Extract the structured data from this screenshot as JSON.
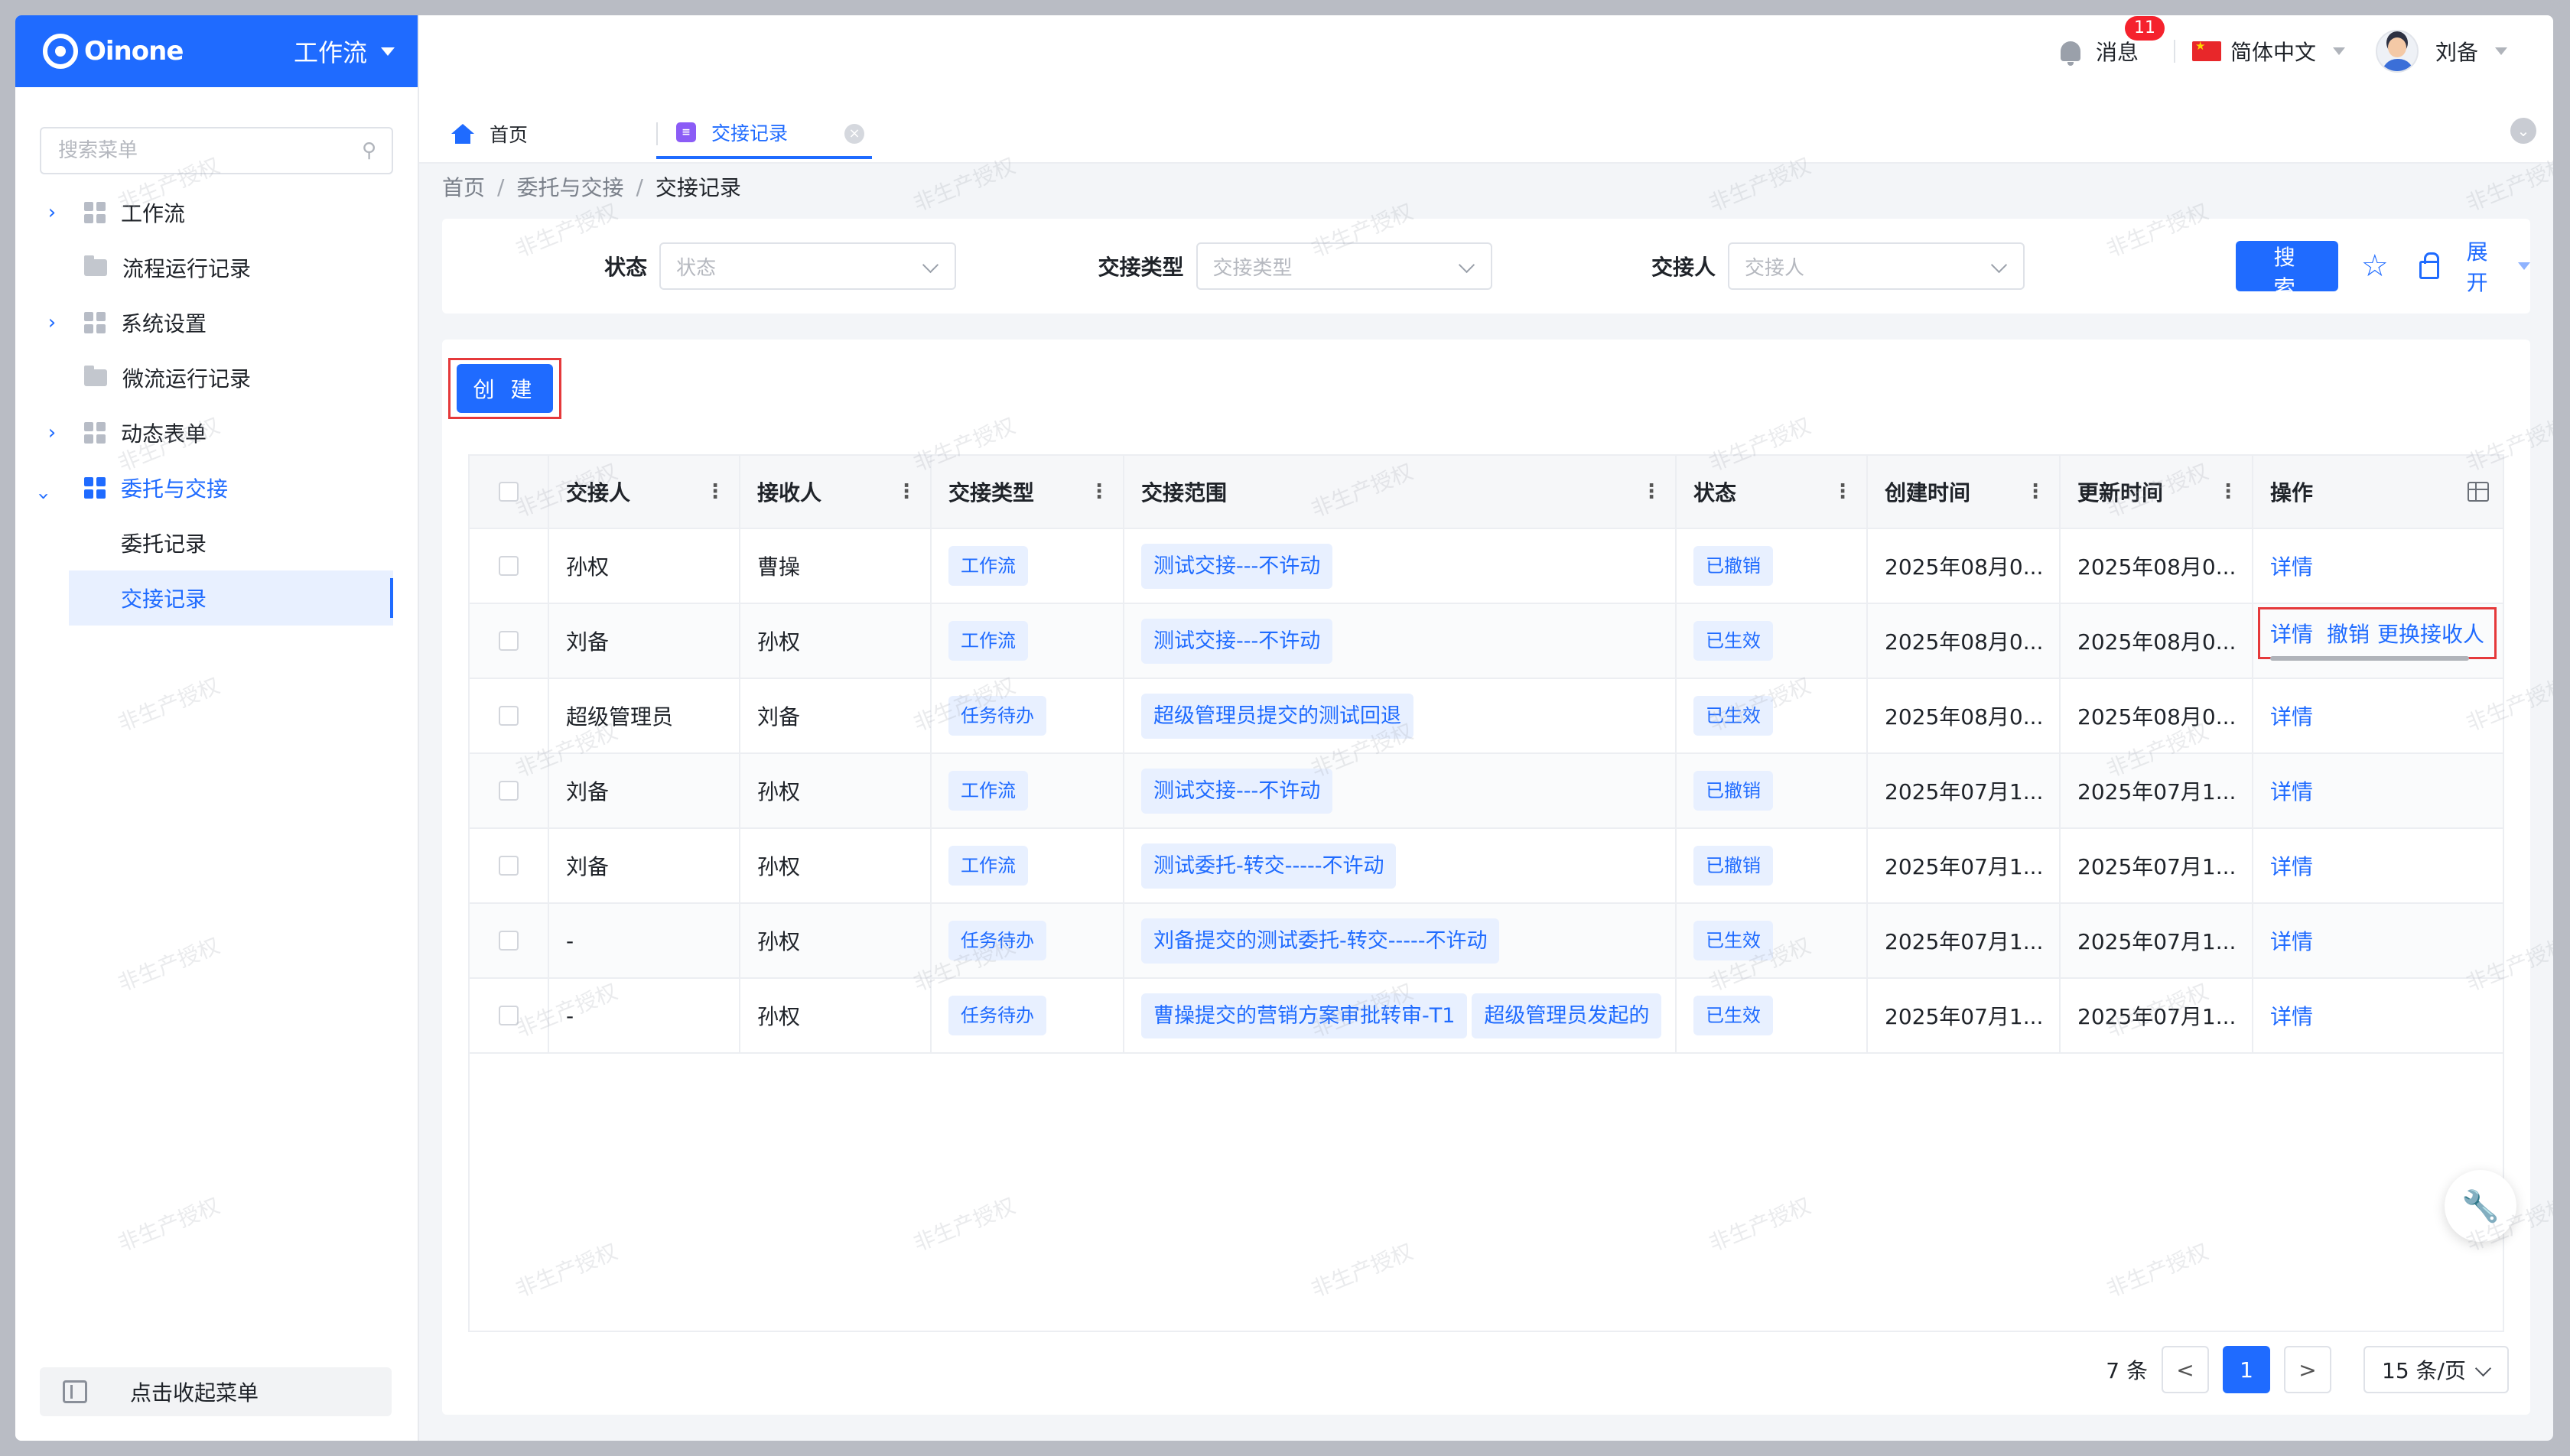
{
  "brand": {
    "name": "Oinone",
    "app": "工作流"
  },
  "sidebar": {
    "search_placeholder": "搜索菜单",
    "items": [
      {
        "label": "工作流"
      },
      {
        "label": "流程运行记录"
      },
      {
        "label": "系统设置"
      },
      {
        "label": "微流运行记录"
      },
      {
        "label": "动态表单"
      },
      {
        "label": "委托与交接"
      },
      {
        "label": "委托记录"
      },
      {
        "label": "交接记录"
      }
    ],
    "collapse_label": "点击收起菜单"
  },
  "topbar": {
    "messages_label": "消息",
    "messages_count": "11",
    "language": "简体中文",
    "user_name": "刘备"
  },
  "tabs": [
    {
      "label": "首页"
    },
    {
      "label": "交接记录"
    }
  ],
  "breadcrumb": [
    "首页",
    "/",
    "委托与交接",
    "/",
    "交接记录"
  ],
  "filters": {
    "status_label": "状态",
    "status_placeholder": "状态",
    "type_label": "交接类型",
    "type_placeholder": "交接类型",
    "handover_label": "交接人",
    "handover_placeholder": "交接人",
    "search_button": "搜 索",
    "expand_label": "展开"
  },
  "create_button": "创 建",
  "table": {
    "headers": [
      "交接人",
      "接收人",
      "交接类型",
      "交接范围",
      "状态",
      "创建时间",
      "更新时间",
      "操作"
    ],
    "rows": [
      {
        "from": "孙权",
        "to": "曹操",
        "type": "工作流",
        "scope": [
          "测试交接---不许动"
        ],
        "status": "已撤销",
        "created": "2025年08月0...",
        "updated": "2025年08月0...",
        "ops": [
          "详情"
        ]
      },
      {
        "from": "刘备",
        "to": "孙权",
        "type": "工作流",
        "scope": [
          "测试交接---不许动"
        ],
        "status": "已生效",
        "created": "2025年08月0...",
        "updated": "2025年08月0...",
        "ops": [
          "详情",
          "撤销",
          "更换接收人"
        ]
      },
      {
        "from": "超级管理员",
        "to": "刘备",
        "type": "任务待办",
        "scope": [
          "超级管理员提交的测试回退"
        ],
        "status": "已生效",
        "created": "2025年08月0...",
        "updated": "2025年08月0...",
        "ops": [
          "详情"
        ]
      },
      {
        "from": "刘备",
        "to": "孙权",
        "type": "工作流",
        "scope": [
          "测试交接---不许动"
        ],
        "status": "已撤销",
        "created": "2025年07月1...",
        "updated": "2025年07月1...",
        "ops": [
          "详情"
        ]
      },
      {
        "from": "刘备",
        "to": "孙权",
        "type": "工作流",
        "scope": [
          "测试委托-转交-----不许动"
        ],
        "status": "已撤销",
        "created": "2025年07月1...",
        "updated": "2025年07月1...",
        "ops": [
          "详情"
        ]
      },
      {
        "from": "-",
        "to": "孙权",
        "type": "任务待办",
        "scope": [
          "刘备提交的测试委托-转交-----不许动"
        ],
        "status": "已生效",
        "created": "2025年07月1...",
        "updated": "2025年07月1...",
        "ops": [
          "详情"
        ]
      },
      {
        "from": "-",
        "to": "孙权",
        "type": "任务待办",
        "scope": [
          "曹操提交的营销方案审批转审-T1",
          "超级管理员发起的"
        ],
        "status": "已生效",
        "created": "2025年07月1...",
        "updated": "2025年07月1...",
        "ops": [
          "详情"
        ]
      }
    ]
  },
  "pagination": {
    "total": "7 条",
    "prev": "<",
    "page": "1",
    "next": ">",
    "page_size": "15 条/页"
  },
  "watermark": "非生产授权",
  "colors": {
    "primary": "#1f6bff",
    "tag_bg": "#e8f0ff",
    "highlight": "#e5393b"
  }
}
